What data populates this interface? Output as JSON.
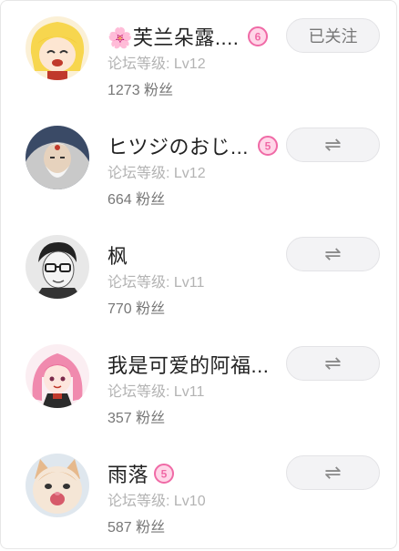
{
  "users": [
    {
      "name": "🌸芙兰朵露....",
      "level": "论坛等级: Lv12",
      "fans": "1273 粉丝",
      "badge": "6",
      "button_label": "已关注",
      "button_icon": null,
      "avatar_icon": "anime-blonde-girl-avatar"
    },
    {
      "name": "ヒツジのおじ...",
      "level": "论坛等级: Lv12",
      "fans": "664 粉丝",
      "badge": "5",
      "button_label": null,
      "button_icon": "⇌",
      "avatar_icon": "white-haired-elder-avatar"
    },
    {
      "name": "枫",
      "level": "论坛等级: Lv11",
      "fans": "770 粉丝",
      "badge": null,
      "button_label": null,
      "button_icon": "⇌",
      "avatar_icon": "glasses-man-sketch-avatar"
    },
    {
      "name": "我是可爱的阿福...",
      "level": "论坛等级: Lv11",
      "fans": "357 粉丝",
      "badge": null,
      "button_label": null,
      "button_icon": "⇌",
      "avatar_icon": "pink-hair-anime-avatar"
    },
    {
      "name": "雨落",
      "level": "论坛等级: Lv10",
      "fans": "587 粉丝",
      "badge": "5",
      "button_label": null,
      "button_icon": "⇌",
      "avatar_icon": "kitten-avatar"
    }
  ],
  "colors": {
    "badge_pink": "#f06aa6",
    "button_bg": "#f3f3f5",
    "name_text": "#222222",
    "level_text": "#b3b3b3",
    "fans_text": "#777777"
  }
}
